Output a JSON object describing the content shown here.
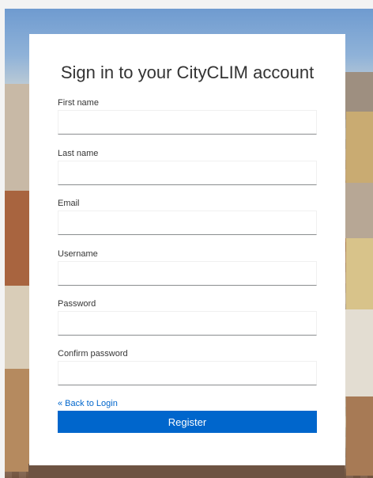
{
  "page": {
    "title": "Sign in to your CityCLIM account"
  },
  "form": {
    "fields": [
      {
        "label": "First name",
        "value": "",
        "type": "text"
      },
      {
        "label": "Last name",
        "value": "",
        "type": "text"
      },
      {
        "label": "Email",
        "value": "",
        "type": "email"
      },
      {
        "label": "Username",
        "value": "",
        "type": "text"
      },
      {
        "label": "Password",
        "value": "",
        "type": "password"
      },
      {
        "label": "Confirm password",
        "value": "",
        "type": "password"
      }
    ],
    "back_link": "« Back to Login",
    "submit_label": "Register"
  },
  "colors": {
    "accent": "#0066cc",
    "card": "#ffffff"
  }
}
